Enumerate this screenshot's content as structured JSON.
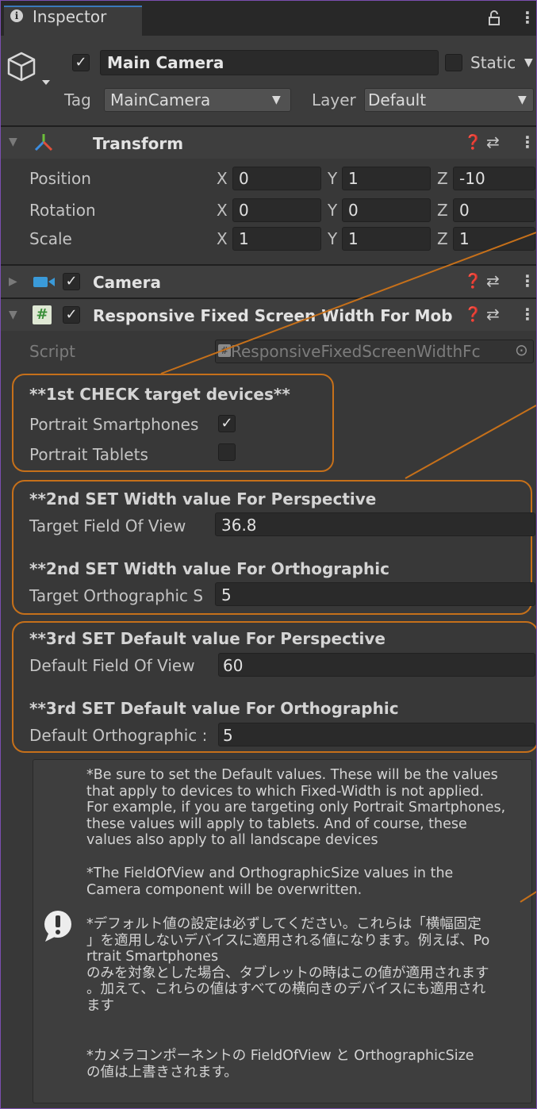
{
  "tab": {
    "title": "Inspector",
    "info_icon": "info-icon",
    "lock_icon": "lock-icon",
    "menu_icon": "kebab-menu-icon"
  },
  "gameobject": {
    "icon": "cube-icon",
    "active": true,
    "name": "Main Camera",
    "static_label": "Static",
    "tag_label": "Tag",
    "tag_value": "MainCamera",
    "layer_label": "Layer",
    "layer_value": "Default"
  },
  "transform": {
    "title": "Transform",
    "rows": [
      {
        "label": "Position",
        "x": "0",
        "y": "1",
        "z": "-10"
      },
      {
        "label": "Rotation",
        "x": "0",
        "y": "0",
        "z": "0"
      },
      {
        "label": "Scale",
        "x": "1",
        "y": "1",
        "z": "1"
      }
    ],
    "axes": {
      "x": "X",
      "y": "Y",
      "z": "Z"
    }
  },
  "camera": {
    "title": "Camera",
    "enabled": true
  },
  "script_component": {
    "title": "Responsive Fixed Screen Width For Mob",
    "enabled": true,
    "script_label": "Script",
    "script_value": "ResponsiveFixedScreenWidthFc",
    "section1": {
      "heading": "**1st CHECK target devices**",
      "portrait_smartphones_label": "Portrait Smartphones",
      "portrait_smartphones": true,
      "portrait_tablets_label": "Portrait Tablets",
      "portrait_tablets": false
    },
    "section2": {
      "heading_persp": "**2nd SET Width value For Perspective",
      "target_fov_label": "Target Field Of View",
      "target_fov_value": "36.8",
      "heading_ortho": "**2nd SET Width value For Orthographic",
      "target_ortho_label": "Target Orthographic S",
      "target_ortho_value": "5"
    },
    "section3": {
      "heading_persp": "**3rd SET Default value For Perspective",
      "default_fov_label": "Default Field Of View",
      "default_fov_value": "60",
      "heading_ortho": "**3rd SET Default value For Orthographic",
      "default_ortho_label": "Default Orthographic :",
      "default_ortho_value": "5"
    },
    "help": {
      "icon": "warning-exclamation-icon",
      "paragraph1": "*Be sure to set the Default values. These will be the values\nthat apply to devices to which Fixed-Width is not applied.\nFor example, if you are targeting only Portrait Smartphones,\nthese values will apply to tablets. And of course, these\nvalues also apply to all landscape devices",
      "paragraph2": "*The FieldOfView and OrthographicSize values in the\nCamera component will be overwritten.",
      "paragraph3": "*デフォルト値の設定は必ずしてください。これらは「横幅固定\n」を適用しないデバイスに適用される値になります。例えば、Po\nrtrait Smartphones\nのみを対象とした場合、タブレットの時はこの値が適用されます\n。加えて、これらの値はすべての横向きのデバイスにも適用され\nます",
      "paragraph4": "*カメラコンポーネントの FieldOfView と OrthographicSize\nの値は上書きされます。"
    }
  },
  "colors": {
    "annotation": "#c6701a",
    "tab_accent": "#3a79bb",
    "background": "#383838"
  }
}
